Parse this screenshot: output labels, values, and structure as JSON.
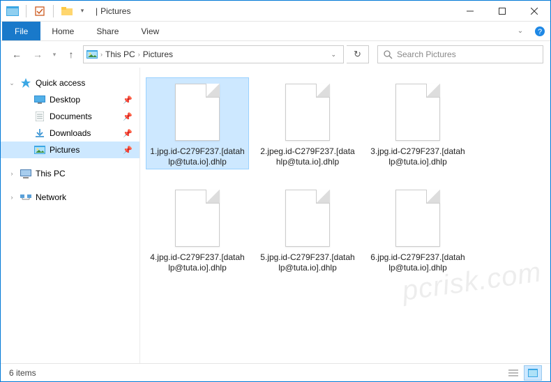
{
  "window": {
    "title": "Pictures",
    "title_sep": "|"
  },
  "ribbon": {
    "file": "File",
    "tabs": [
      "Home",
      "Share",
      "View"
    ]
  },
  "nav": {
    "crumbs": [
      "This PC",
      "Pictures"
    ]
  },
  "search": {
    "placeholder": "Search Pictures"
  },
  "sidebar": {
    "quick_access": "Quick access",
    "items": [
      {
        "label": "Desktop",
        "icon": "desktop",
        "pinned": true
      },
      {
        "label": "Documents",
        "icon": "documents",
        "pinned": true
      },
      {
        "label": "Downloads",
        "icon": "downloads",
        "pinned": true
      },
      {
        "label": "Pictures",
        "icon": "pictures",
        "pinned": true,
        "selected": true
      }
    ],
    "this_pc": "This PC",
    "network": "Network"
  },
  "files": [
    {
      "name": "1.jpg.id-C279F237.[datahlp@tuta.io].dhlp",
      "selected": true
    },
    {
      "name": "2.jpeg.id-C279F237.[datahlp@tuta.io].dhlp"
    },
    {
      "name": "3.jpg.id-C279F237.[datahlp@tuta.io].dhlp"
    },
    {
      "name": "4.jpg.id-C279F237.[datahlp@tuta.io].dhlp"
    },
    {
      "name": "5.jpg.id-C279F237.[datahlp@tuta.io].dhlp"
    },
    {
      "name": "6.jpg.id-C279F237.[datahlp@tuta.io].dhlp"
    }
  ],
  "status": {
    "count": "6 items"
  },
  "watermark": "pcrisk.com"
}
